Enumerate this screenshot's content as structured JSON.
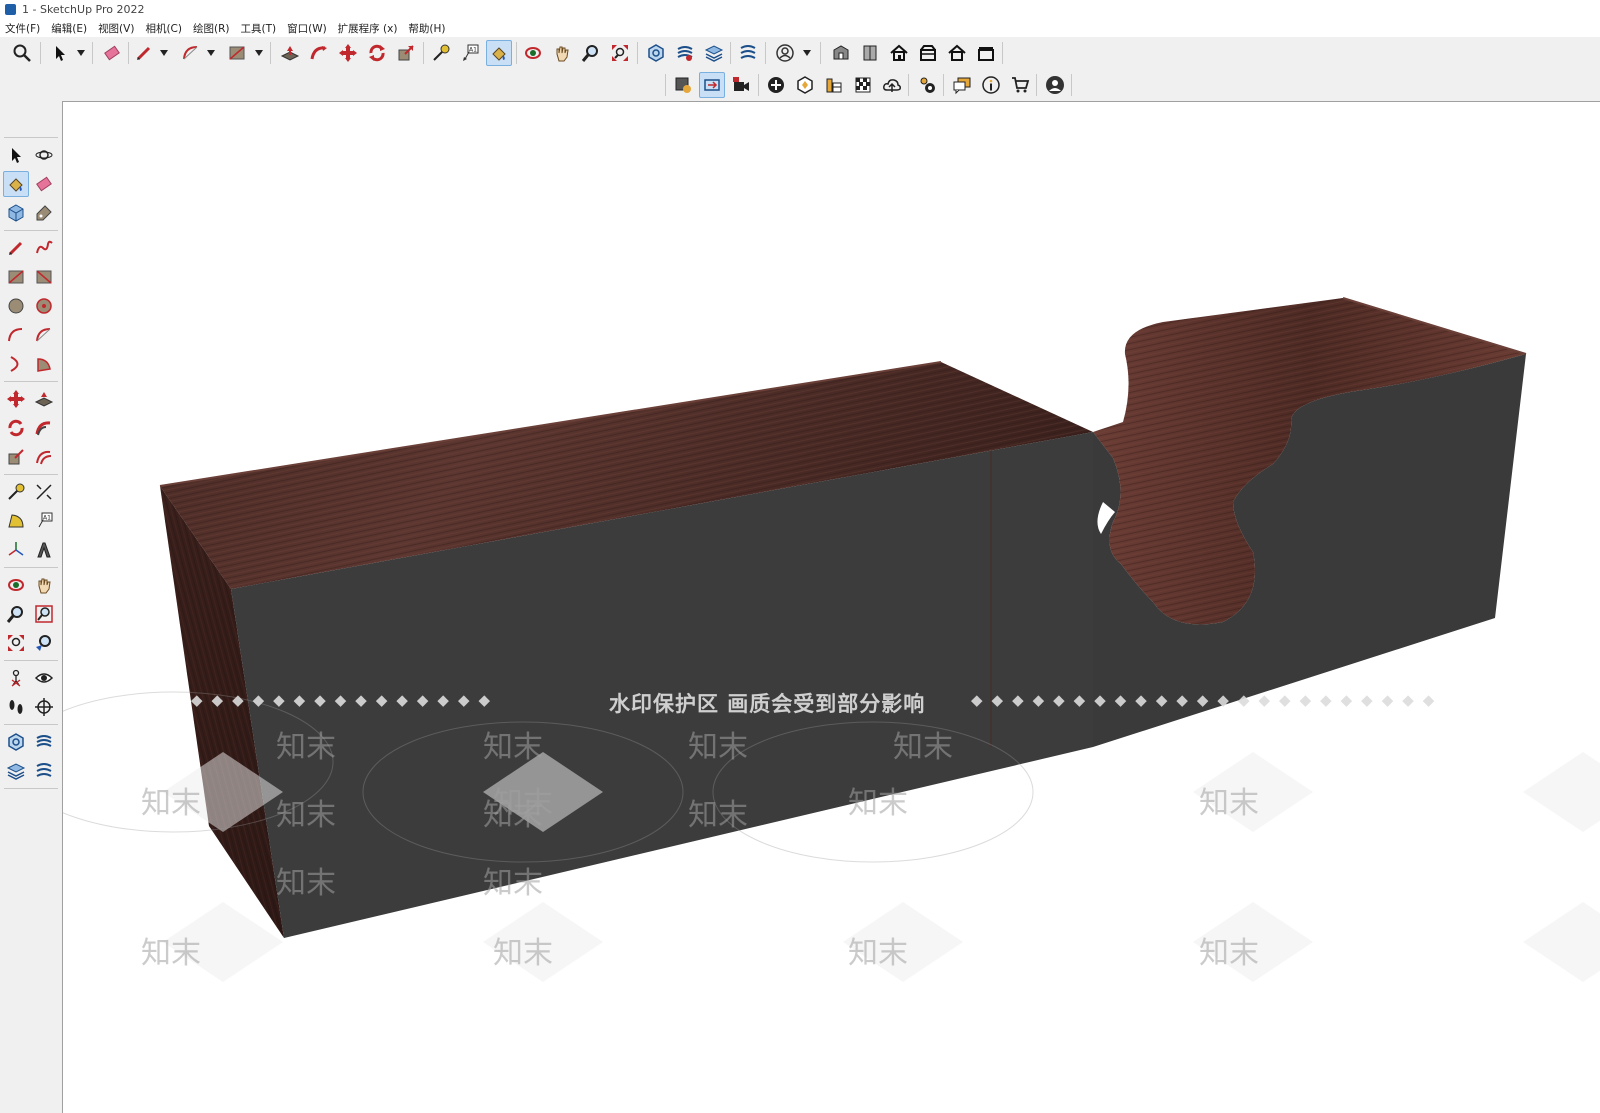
{
  "window": {
    "title": "1 - SketchUp Pro 2022"
  },
  "menubar": {
    "items": [
      "文件(F)",
      "编辑(E)",
      "视图(V)",
      "相机(C)",
      "绘图(R)",
      "工具(T)",
      "窗口(W)",
      "扩展程序 (x)",
      "帮助(H)"
    ]
  },
  "toolbar_top": {
    "icons": [
      "zoom-icon",
      "select-icon",
      "eraser-icon",
      "pencil-icon",
      "arc-icon",
      "rectangle-icon",
      "push-pull-icon",
      "follow-me-icon",
      "move-icon",
      "rotate-icon",
      "scale-icon",
      "tape-measure-icon",
      "text-icon",
      "paint-bucket-icon",
      "orbit-icon",
      "pan-icon",
      "zoom-tool-icon",
      "zoom-extents-icon",
      "solid-inspector-icon",
      "outer-shell-icon",
      "layers-icon",
      "sandbox-icon",
      "account-icon",
      "warehouse-icon",
      "components-icon",
      "house-icon",
      "house2-icon",
      "house3-icon",
      "house4-icon"
    ]
  },
  "toolbar_second": {
    "icons": [
      "style-icon",
      "scene-icon",
      "camera-icon",
      "add-icon",
      "section-icon",
      "shadow-icon",
      "checker-icon",
      "cloud-upload-icon",
      "settings-icon",
      "chat-icon",
      "info-icon",
      "cart-icon",
      "user-icon"
    ]
  },
  "left_toolbar": {
    "icons": [
      "select-icon",
      "orbit-3d-icon",
      "paint-bucket-icon",
      "eraser-icon",
      "components-icon",
      "tag-icon",
      "pencil-icon",
      "freehand-icon",
      "rectangle-icon",
      "rotated-rectangle-icon",
      "circle-icon",
      "polygon-icon",
      "arc-icon",
      "two-point-arc-icon",
      "three-point-arc-icon",
      "pie-icon",
      "move-icon",
      "push-pull-icon",
      "rotate-icon",
      "follow-me-icon",
      "scale-icon",
      "offset-icon",
      "tape-measure-icon",
      "dimension-icon",
      "protractor-icon",
      "text-icon",
      "axes-icon",
      "3d-text-icon",
      "orbit-icon",
      "pan-icon",
      "zoom-icon",
      "zoom-window-icon",
      "zoom-extents-icon",
      "previous-view-icon",
      "position-camera-icon",
      "look-around-icon",
      "walk-icon",
      "section-plane-icon",
      "solid-tools-icon",
      "outer-shell-icon",
      "layers-icon",
      "sandbox-icon"
    ]
  },
  "viewport": {
    "watermark_banner": "水印保护区   画质会受到部分影响",
    "watermark_logo": "知末"
  },
  "colors": {
    "wood_dark": "#3a2420",
    "wood_mid": "#5a3530",
    "fabric": "#3c3c3c",
    "active_button": "#c9dff5"
  }
}
